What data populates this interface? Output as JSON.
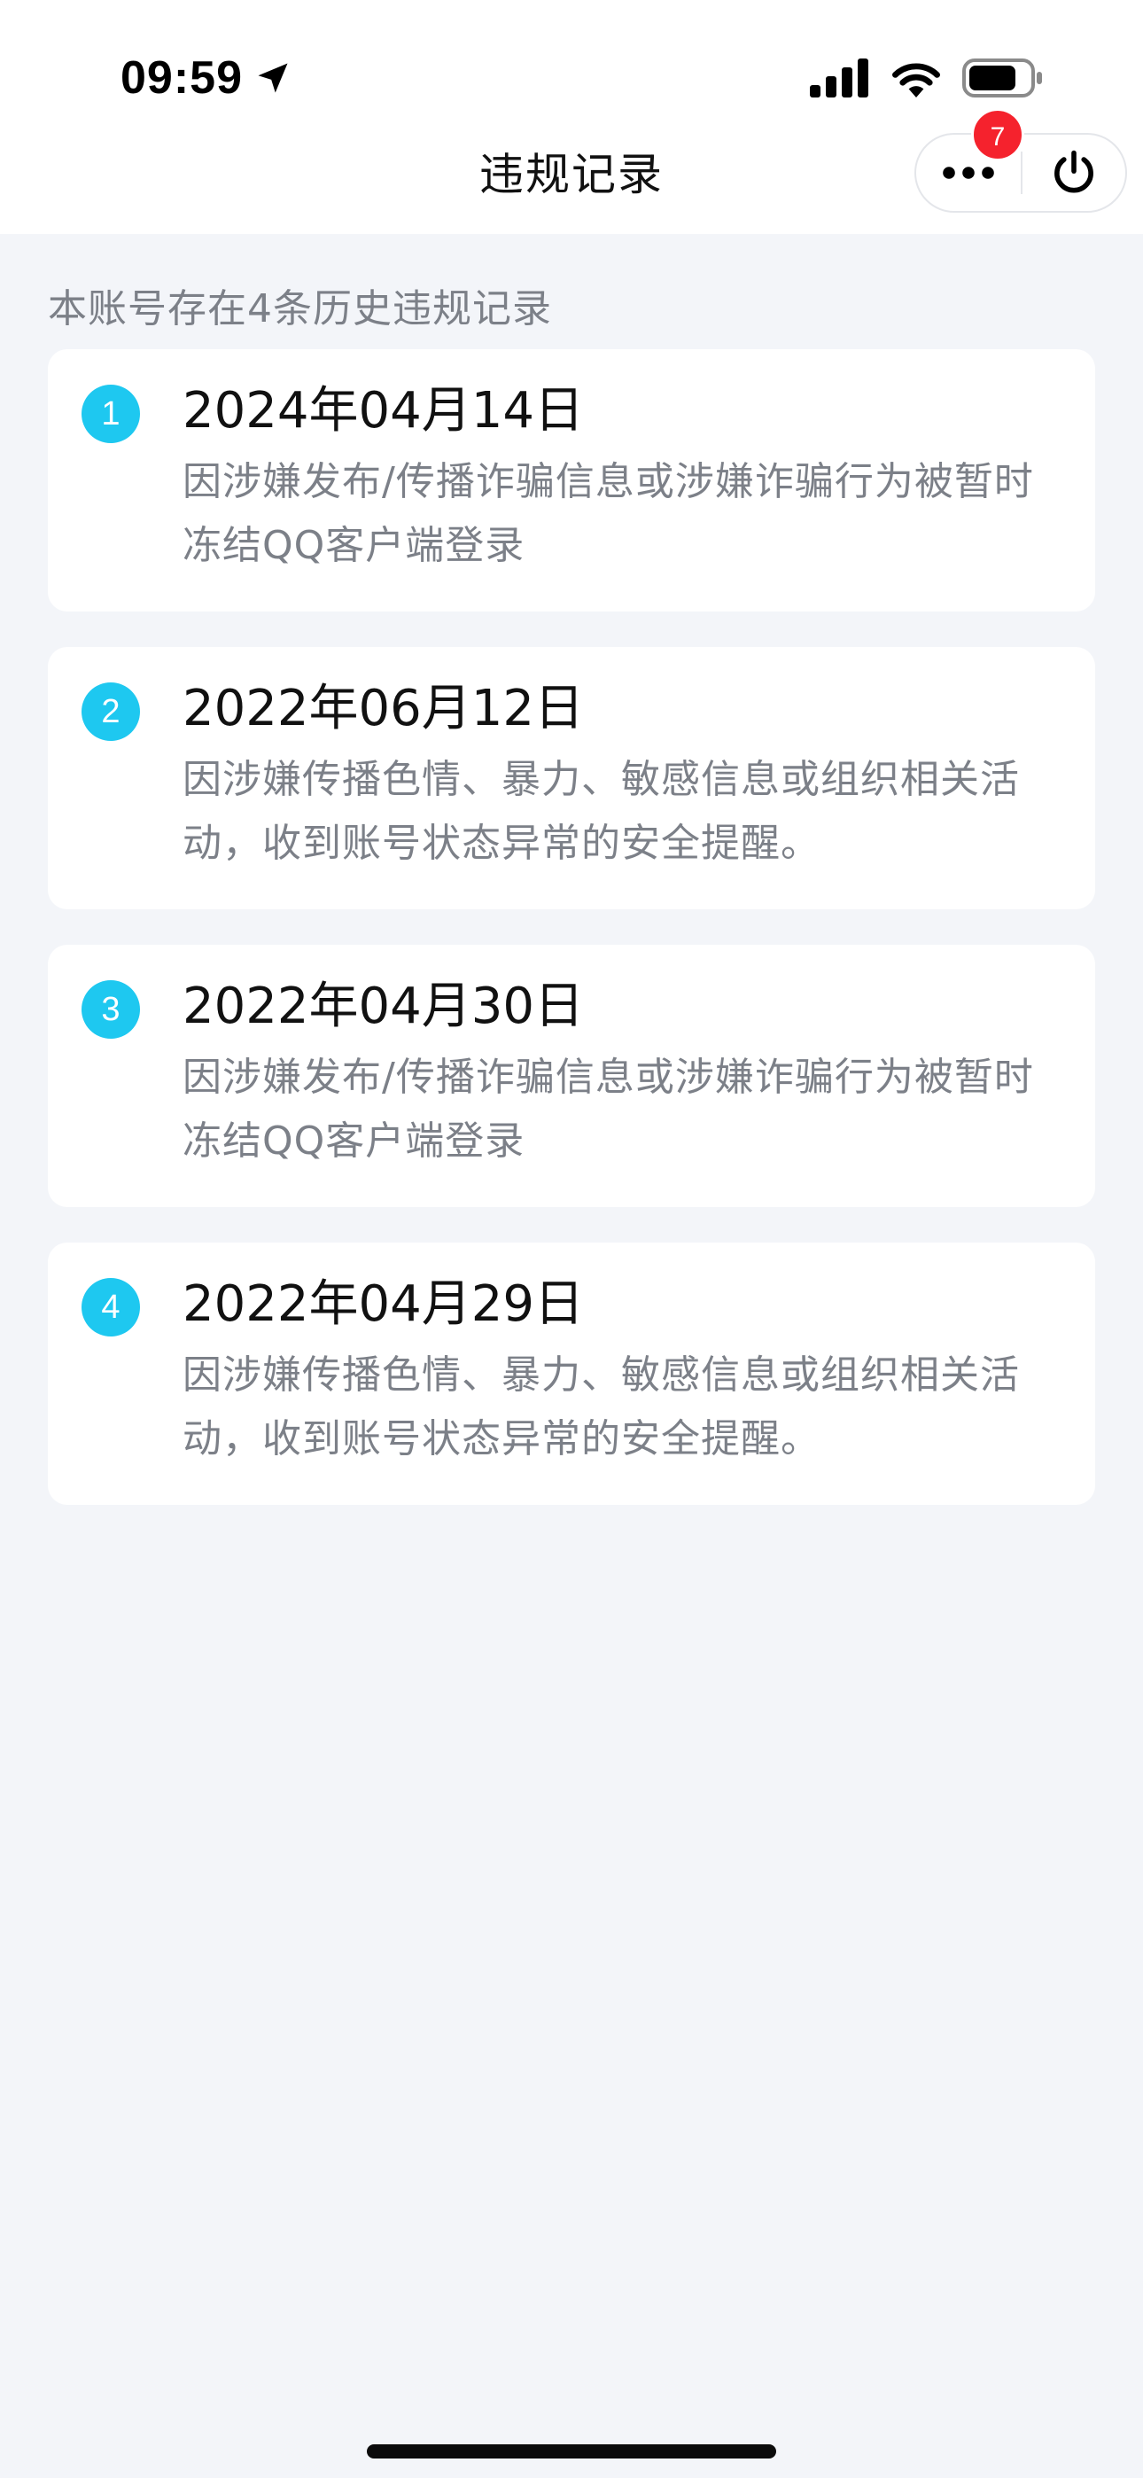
{
  "status_bar": {
    "time": "09:59",
    "icons": [
      "location-arrow-icon",
      "signal-icon",
      "wifi-icon",
      "battery-icon"
    ]
  },
  "nav": {
    "title": "违规记录",
    "badge_count": "7",
    "more_icon": "more-dots-icon",
    "close_icon": "power-icon"
  },
  "summary": "本账号存在4条历史违规记录",
  "records": [
    {
      "index": "1",
      "date": "2024年04月14日",
      "description": "因涉嫌发布/传播诈骗信息或涉嫌诈骗行为被暂时冻结QQ客户端登录"
    },
    {
      "index": "2",
      "date": "2022年06月12日",
      "description": "因涉嫌传播色情、暴力、敏感信息或组织相关活动，收到账号状态异常的安全提醒。"
    },
    {
      "index": "3",
      "date": "2022年04月30日",
      "description": "因涉嫌发布/传播诈骗信息或涉嫌诈骗行为被暂时冻结QQ客户端登录"
    },
    {
      "index": "4",
      "date": "2022年04月29日",
      "description": "因涉嫌传播色情、暴力、敏感信息或组织相关活动，收到账号状态异常的安全提醒。"
    }
  ],
  "colors": {
    "accent": "#1ec8f0",
    "badge": "#f5222d",
    "page_background": "#f3f5f9",
    "secondary_text": "#7c8088"
  }
}
